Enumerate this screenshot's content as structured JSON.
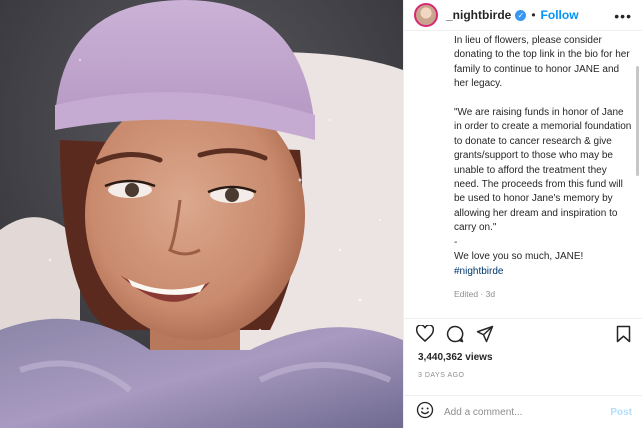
{
  "header": {
    "username": "_nightbirde",
    "verified_icon": "verified-badge-icon",
    "separator": "•",
    "follow_label": "Follow",
    "more_icon": "more-options-icon"
  },
  "caption": {
    "paragraph1": "In lieu of flowers, please consider donating to the top link in the bio for her family to continue to honor JANE and her legacy.",
    "paragraph2": "\"We are raising funds in honor of Jane in order to create a memorial foundation to donate to cancer research & give grants/support to those who may be unable to afford the treatment they need. The proceeds from this fund will be used to honor Jane's memory by allowing her dream and inspiration to carry on.\"",
    "dash": "-",
    "closing": "We love you so much, JANE!",
    "hashtag": "#nightbirde",
    "edited": "Edited · 3d"
  },
  "actions": {
    "like_icon": "heart-icon",
    "comment_icon": "comment-icon",
    "share_icon": "share-icon",
    "save_icon": "bookmark-icon"
  },
  "stats": {
    "views": "3,440,362 views",
    "time_ago": "3 DAYS AGO"
  },
  "comment_box": {
    "emoji_icon": "emoji-icon",
    "placeholder": "Add a comment...",
    "post_label": "Post"
  },
  "colors": {
    "accent": "#0095f6",
    "hashtag": "#00376b",
    "muted": "#8e8e8e"
  }
}
